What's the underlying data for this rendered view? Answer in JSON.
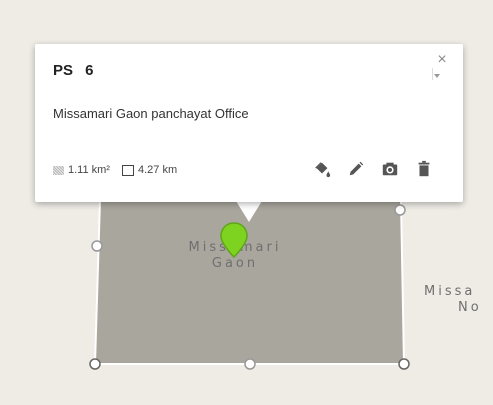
{
  "map": {
    "place_main_line1": "Missamari",
    "place_main_line2": "Gaon",
    "place_right_line1": "Missa",
    "place_right_line2": "No"
  },
  "infowindow": {
    "title": "PS 6",
    "description": "Missamari Gaon panchayat Office",
    "area": "1.11 km²",
    "perimeter": "4.27 km",
    "close_symbol": "×"
  },
  "icons": {
    "fill": "paint-bucket-icon",
    "edit": "pencil-icon",
    "photo": "camera-icon",
    "delete": "trash-icon"
  },
  "colors": {
    "polygon_fill": "#a9a69d",
    "marker": "#7ed321"
  }
}
